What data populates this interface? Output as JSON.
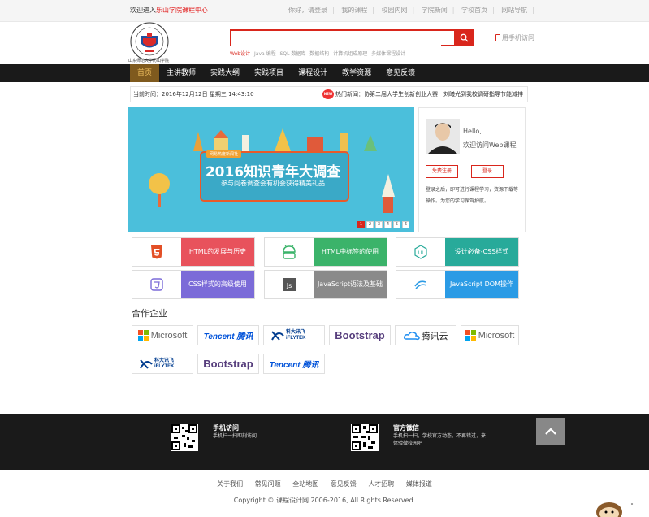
{
  "topbar": {
    "welcome_prefix": "欢迎进入",
    "welcome_link": "乐山学院课程中心",
    "links": [
      "你好，请登录",
      "我的课程",
      "校园内网",
      "学院新闻",
      "学校首页",
      "网站导航"
    ]
  },
  "header": {
    "logo_caption": "山东师范大学历山学院",
    "search_placeholder": "",
    "hotwords": [
      "Web设计",
      "Java 编程",
      "SQL 数据库",
      "数据结构",
      "计算机组成原理",
      "多媒体课程设计"
    ],
    "mobile_label": "用手机访问"
  },
  "nav": {
    "items": [
      "首页",
      "主讲教师",
      "实践大纲",
      "实践项目",
      "课程设计",
      "教学资源",
      "意见反馈"
    ]
  },
  "datebar": {
    "date": "当前时间：2016年12月12日 星期三 14:43:10",
    "badge": "NEW",
    "news": "热门新闻：协第二届大学生创新创业大赛　刘曦光到我校调研指导节能减排"
  },
  "banner": {
    "tag": "网易热度新闻社",
    "title": "2016知识青年大调查",
    "subtitle": "参与问卷调查会有机会获得精美礼品",
    "pages": [
      "1",
      "2",
      "3",
      "4",
      "5",
      "6"
    ]
  },
  "userbox": {
    "hello": "Hello,",
    "welcome": "欢迎访问Web课程",
    "register": "免费注册",
    "login": "登录",
    "tip": "登录之后，即可进行课程学习，资源下载等操作。为您的学习保驾护航。"
  },
  "cards": [
    {
      "label": "HTML的发展与历史",
      "icon": "html5-icon",
      "color": "#e8525c"
    },
    {
      "label": "HTML中标签的使用",
      "icon": "android-icon",
      "color": "#3bb36a"
    },
    {
      "label": "设计必备-CSS样式",
      "icon": "ui-icon",
      "color": "#28aa9a"
    },
    {
      "label": "CSS样式的高级使用",
      "icon": "css3-icon",
      "color": "#7b6bd8"
    },
    {
      "label": "JavaScript语法及基础",
      "icon": "js-icon",
      "color": "#8a8a8a"
    },
    {
      "label": "JavaScript DOM操作",
      "icon": "swirl-icon",
      "color": "#2b9be5"
    }
  ],
  "partners": {
    "title": "合作企业",
    "row1": [
      "Microsoft",
      "Tencent 腾讯",
      "科大讯飞 iFLYTEK",
      "Bootstrap",
      "腾讯云",
      "Microsoft"
    ],
    "row2": [
      "科大讯飞 iFLYTEK",
      "Bootstrap",
      "Tencent 腾讯"
    ]
  },
  "footer": {
    "mobile_title": "手机访问",
    "mobile_desc": "手机扫一扫即刻访问",
    "wechat_title": "官方微信",
    "wechat_desc": "手机扫一扫，学校官方动态，不再错过，来体验微校园吧",
    "links": [
      "关于我们",
      "常见问题",
      "全站地图",
      "意见反馈",
      "人才招聘",
      "媒体报道"
    ],
    "copyright": "Copyright © 课程设计网 2006-2016, All Rights Reserved."
  }
}
